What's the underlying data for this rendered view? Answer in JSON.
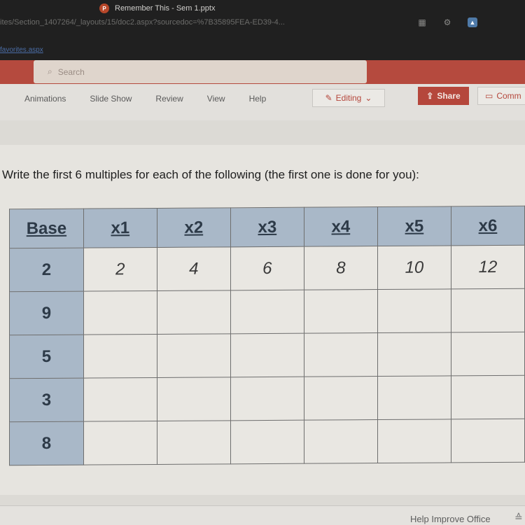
{
  "browser": {
    "tab_title": "Remember This - Sem 1.pptx",
    "app_badge": "P",
    "url": "ites/Section_1407264/_layouts/15/doc2.aspx?sourcedoc=%7B35895FEA-ED39-4...",
    "favorites_link": "favorites.aspx",
    "icons": [
      "grid-icon",
      "settings-icon",
      "profile-icon"
    ]
  },
  "office": {
    "search_placeholder": "Search",
    "ribbon_tabs": [
      "Animations",
      "Slide Show",
      "Review",
      "View",
      "Help"
    ],
    "editing_label": "Editing",
    "share_label": "Share",
    "comments_label": "Comm"
  },
  "slide": {
    "instruction": "Write the first 6 multiples for each of the following (the first one is done for you):",
    "table": {
      "headers": [
        "Base",
        "x1",
        "x2",
        "x3",
        "x4",
        "x5",
        "x6"
      ],
      "rows": [
        {
          "base": "2",
          "values": [
            "2",
            "4",
            "6",
            "8",
            "10",
            "12"
          ]
        },
        {
          "base": "9",
          "values": [
            "",
            "",
            "",
            "",
            "",
            ""
          ]
        },
        {
          "base": "5",
          "values": [
            "",
            "",
            "",
            "",
            "",
            ""
          ]
        },
        {
          "base": "3",
          "values": [
            "",
            "",
            "",
            "",
            "",
            ""
          ]
        },
        {
          "base": "8",
          "values": [
            "",
            "",
            "",
            "",
            "",
            ""
          ]
        }
      ]
    }
  },
  "status_bar": {
    "help_improve": "Help Improve Office"
  }
}
